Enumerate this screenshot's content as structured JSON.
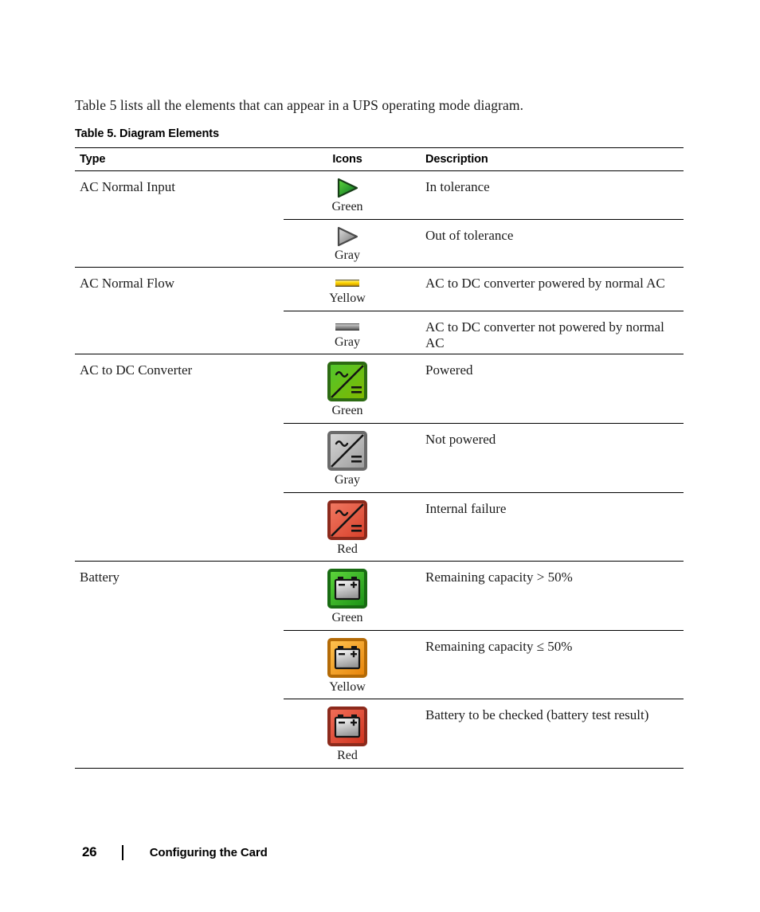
{
  "intro": {
    "text": "Table 5 lists all the elements that can appear in a UPS operating mode diagram."
  },
  "table": {
    "caption": "Table 5. Diagram Elements",
    "headers": {
      "type": "Type",
      "icons": "Icons",
      "description": "Description"
    },
    "groups": [
      {
        "type": "AC Normal Input",
        "rows": [
          {
            "icon": "arrow-right-green-icon",
            "icon_label": "Green",
            "description": "In tolerance"
          },
          {
            "icon": "arrow-right-gray-icon",
            "icon_label": "Gray",
            "description": "Out of tolerance"
          }
        ]
      },
      {
        "type": "AC Normal Flow",
        "rows": [
          {
            "icon": "flow-bar-yellow-icon",
            "icon_label": "Yellow",
            "description": "AC to DC converter powered by normal AC"
          },
          {
            "icon": "flow-bar-gray-icon",
            "icon_label": "Gray",
            "description": "AC to DC converter not powered by normal AC"
          }
        ]
      },
      {
        "type": "AC to DC Converter",
        "rows": [
          {
            "icon": "converter-green-icon",
            "icon_label": "Green",
            "description": "Powered"
          },
          {
            "icon": "converter-gray-icon",
            "icon_label": "Gray",
            "description": "Not powered"
          },
          {
            "icon": "converter-red-icon",
            "icon_label": "Red",
            "description": "Internal failure"
          }
        ]
      },
      {
        "type": "Battery",
        "rows": [
          {
            "icon": "battery-green-icon",
            "icon_label": "Green",
            "description": "Remaining capacity > 50%"
          },
          {
            "icon": "battery-yellow-icon",
            "icon_label": "Yellow",
            "description": "Remaining capacity ≤ 50%"
          },
          {
            "icon": "battery-red-icon",
            "icon_label": "Red",
            "description": "Battery to be checked (battery test result)"
          }
        ]
      }
    ]
  },
  "footer": {
    "page_number": "26",
    "section": "Configuring the Card"
  },
  "colors": {
    "green_light": "#5fcf3a",
    "green_dark": "#046b22",
    "gray_light": "#d2d2d2",
    "gray_dark": "#6e6e6e",
    "red_light": "#ef6a52",
    "red_dark": "#c0392b",
    "yellow_light": "#ffd800",
    "orange_light": "#ffb13a",
    "orange_dark": "#e8860c",
    "rule": "#000000"
  }
}
